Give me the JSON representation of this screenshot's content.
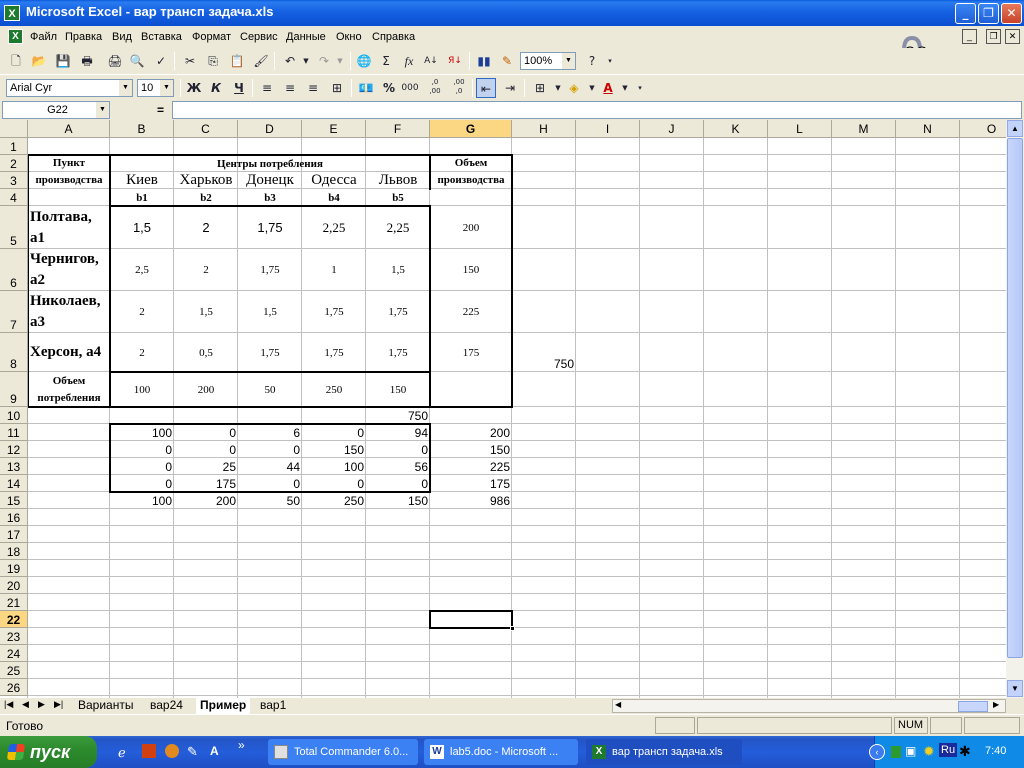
{
  "window": {
    "title": "Microsoft Excel - вар трансп задача.xls",
    "app_icon": "excel-icon"
  },
  "menu": [
    "Файл",
    "Правка",
    "Вид",
    "Вставка",
    "Формат",
    "Сервис",
    "Данные",
    "Окно",
    "Справка"
  ],
  "toolbar": {
    "zoom": "100%",
    "font": "Arial Cyr",
    "size": "10",
    "bold": "Ж",
    "italic": "К",
    "underline": "Ч",
    "thousands": "000",
    "fx": "fx",
    "sigma": "Σ",
    "percent": "%",
    "inc_dec": ",0 ,00",
    "dec_dec": ",00 ,0"
  },
  "formula_bar": {
    "name_box": "G22",
    "equals": "=",
    "value": ""
  },
  "columns": [
    "A",
    "B",
    "C",
    "D",
    "E",
    "F",
    "G",
    "H",
    "I",
    "J",
    "K",
    "L",
    "M",
    "N",
    "O"
  ],
  "rows": [
    "1",
    "2",
    "3",
    "4",
    "5",
    "6",
    "7",
    "8",
    "9",
    "10",
    "11",
    "12",
    "13",
    "14",
    "15",
    "16",
    "17",
    "18",
    "19",
    "20",
    "21",
    "22",
    "23",
    "24",
    "25",
    "26"
  ],
  "sheet": {
    "header_point": "Пункт производства",
    "header_centers": "Центры потребления",
    "header_volume": "Объем производства",
    "cities": [
      "Киев",
      "Харьков",
      "Донецк",
      "Одесса",
      "Львов"
    ],
    "b_labels": [
      "b1",
      "b2",
      "b3",
      "b4",
      "b5"
    ],
    "row_labels": [
      "Полтава, а1",
      "Чернигов, а2",
      "Николаев, а3",
      "Херсон, а4"
    ],
    "costs": [
      [
        "1,5",
        "2",
        "1,75",
        "2,25",
        "2,25"
      ],
      [
        "2,5",
        "2",
        "1,75",
        "1",
        "1,5"
      ],
      [
        "2",
        "1,5",
        "1,5",
        "1,75",
        "1,75"
      ],
      [
        "2",
        "0,5",
        "1,75",
        "1,75",
        "1,75"
      ]
    ],
    "production": [
      "200",
      "150",
      "225",
      "175"
    ],
    "h8": "750",
    "consumption_label": "Объем потребления",
    "consumption": [
      "100",
      "200",
      "50",
      "250",
      "150"
    ],
    "f10": "750",
    "plan": [
      [
        "100",
        "0",
        "6",
        "0",
        "94"
      ],
      [
        "0",
        "0",
        "0",
        "150",
        "0"
      ],
      [
        "0",
        "25",
        "44",
        "100",
        "56"
      ],
      [
        "0",
        "175",
        "0",
        "0",
        "0"
      ]
    ],
    "plan_g": [
      "200",
      "150",
      "225",
      "175"
    ],
    "totals": [
      "100",
      "200",
      "50",
      "250",
      "150"
    ],
    "g15": "986"
  },
  "sheet_tabs": [
    "Варианты",
    "вар24",
    "Пример",
    "вар1"
  ],
  "active_tab": "Пример",
  "status": {
    "ready": "Готово",
    "num": "NUM"
  },
  "taskbar": {
    "start": "пуск",
    "tasks": [
      "Total Commander 6.0...",
      "lab5.doc - Microsoft ...",
      "вар трансп задача.xls"
    ],
    "active_task": 2,
    "lang": "Ru",
    "clock": "7:40",
    "chevron": "»"
  }
}
